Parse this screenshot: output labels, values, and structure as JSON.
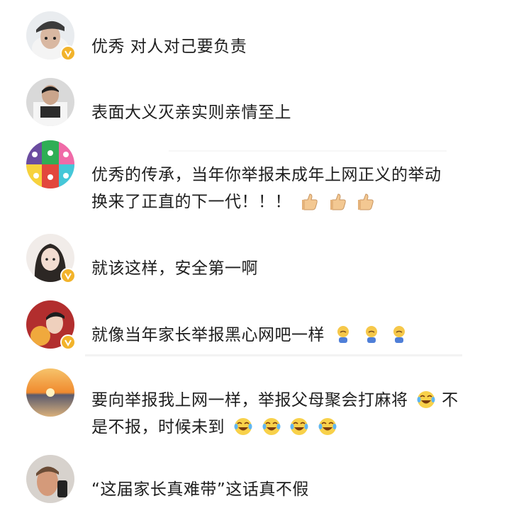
{
  "comments": [
    {
      "text": "优秀 对人对己要负责",
      "verified": true,
      "avatar": "avatar-man-cap",
      "emojis": []
    },
    {
      "text": "表面大义灭亲实则亲情至上",
      "verified": false,
      "avatar": "avatar-man-tshirt",
      "emojis": []
    },
    {
      "text_lines": [
        "优秀的传承，当年你举报未成年上网正义的举动",
        "换来了正直的下一代！！！"
      ],
      "verified": false,
      "avatar": "avatar-cartoon-rabbits",
      "emojis": [
        "thumbs-up-icon",
        "thumbs-up-icon",
        "thumbs-up-icon"
      ]
    },
    {
      "text": "就该这样，安全第一啊",
      "verified": true,
      "avatar": "avatar-woman",
      "emojis": []
    },
    {
      "text": "就像当年家长举报黑心网吧一样",
      "verified": true,
      "avatar": "avatar-young-man-tiger",
      "emojis": [
        "sad-kneel-icon",
        "sad-kneel-icon",
        "sad-kneel-icon"
      ]
    },
    {
      "text_lines": [
        "要向举报我上网一样，举报父母聚会打麻将",
        "不",
        "是不报，时候未到"
      ],
      "verified": false,
      "avatar": "avatar-sunset",
      "emojis_inline": [
        "laugh-cry-icon"
      ],
      "emojis": [
        "laugh-cry-icon",
        "laugh-cry-icon",
        "laugh-cry-icon",
        "laugh-cry-icon"
      ]
    },
    {
      "text": "“这届家长真难带”这话真不假",
      "verified": false,
      "avatar": "avatar-man-selfie",
      "emojis": []
    }
  ],
  "colors": {
    "badge": "#f2b32b",
    "text": "#1e1e1e",
    "divider": "#f3f3f3"
  }
}
